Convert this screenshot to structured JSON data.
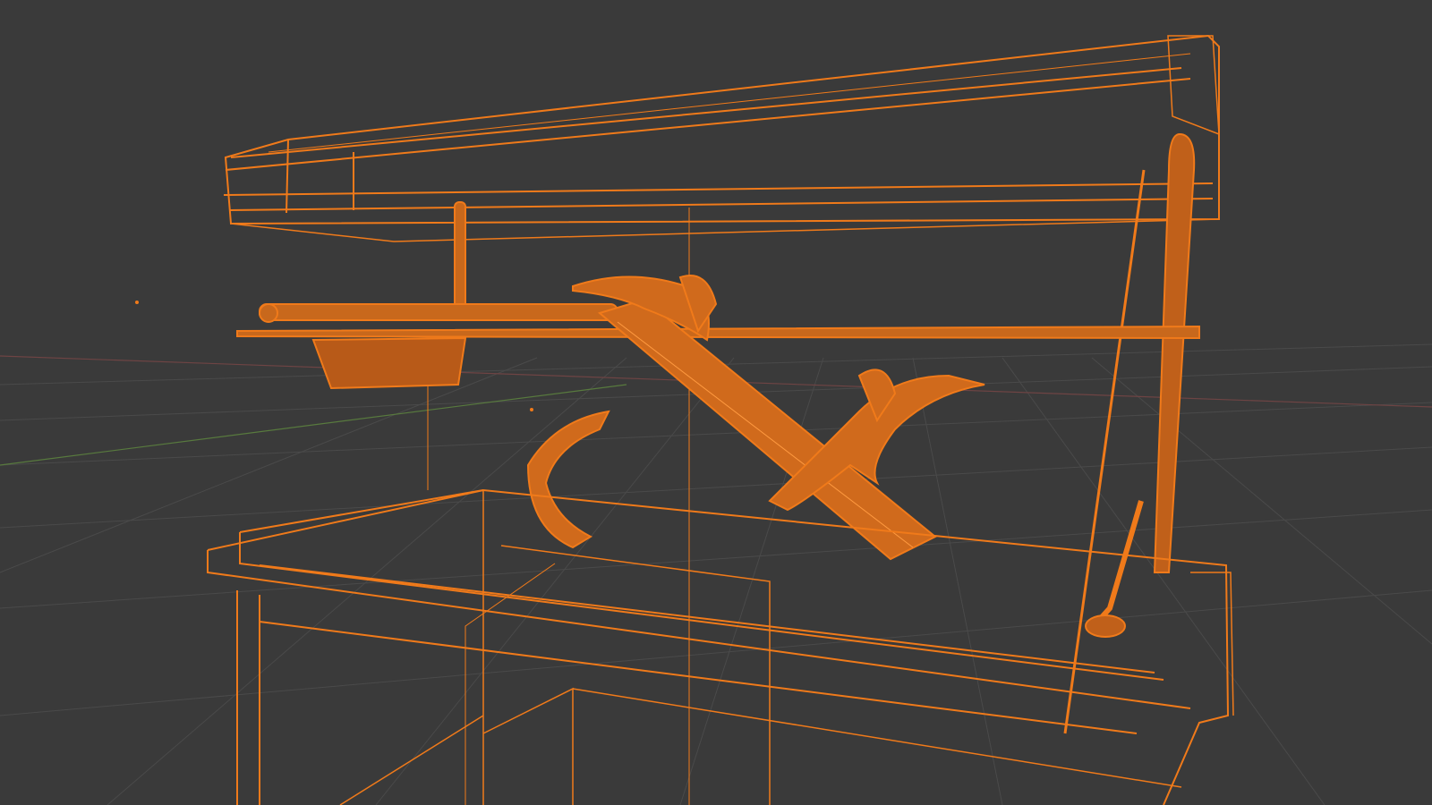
{
  "viewport": {
    "background": "#3a3a3a",
    "grid_color": "#4a4a4a",
    "x_axis_color": "#7a4a4a",
    "y_axis_color": "#5c7a45",
    "wire_color": "#f07a1a",
    "wire_dim_color": "#c8681c",
    "shading_mode": "wireframe",
    "objects": [
      {
        "name": "top-shelf-icon"
      },
      {
        "name": "table-frame-icon"
      },
      {
        "name": "slide-ramp-icon"
      },
      {
        "name": "creature-models-icon"
      }
    ]
  }
}
